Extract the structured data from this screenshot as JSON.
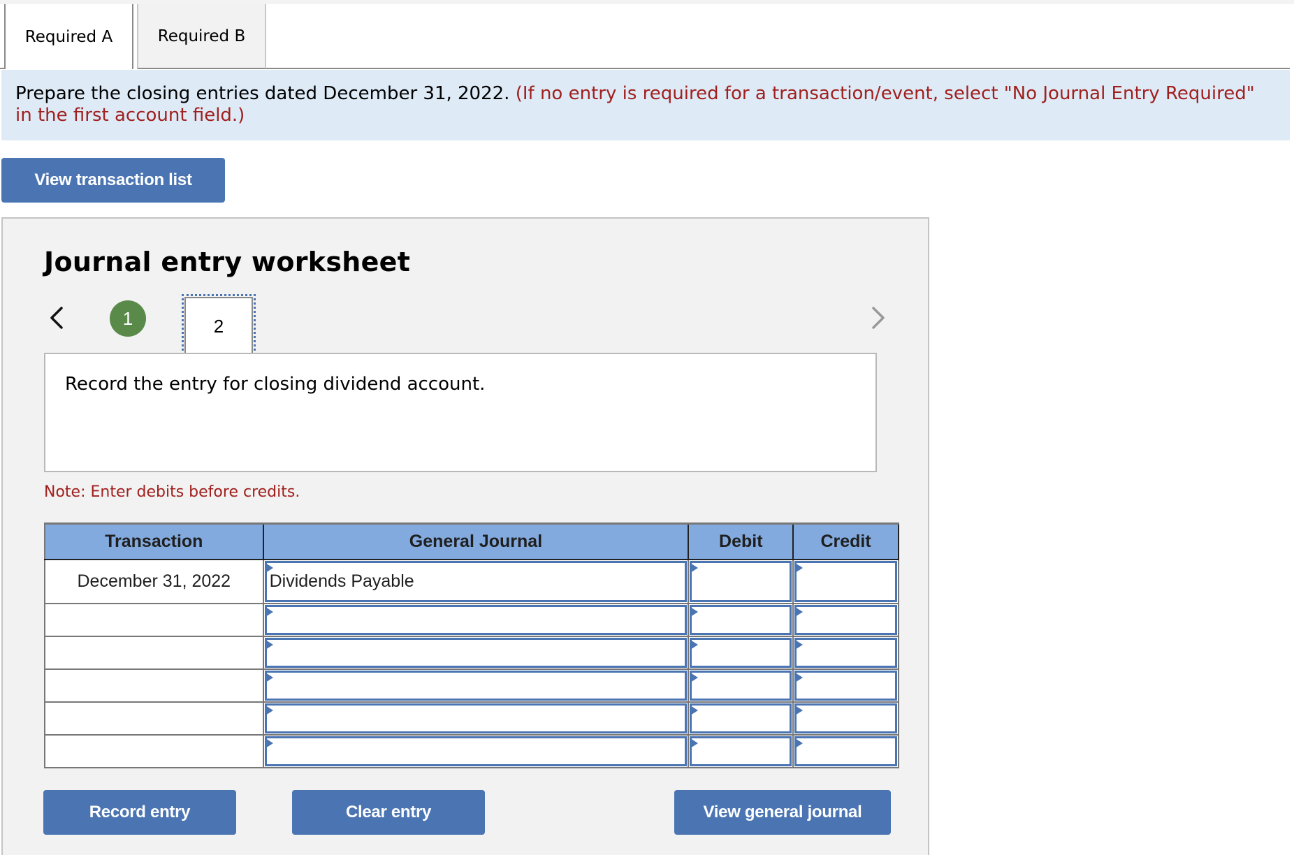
{
  "tabs": [
    {
      "label": "Required A",
      "active": true
    },
    {
      "label": "Required B",
      "active": false
    }
  ],
  "instructions": {
    "main_text": "Prepare the closing entries dated December 31, 2022.",
    "hint_text": "(If no entry is required for a transaction/event, select \"No Journal Entry Required\" in the first account field.)"
  },
  "view_transaction_list_label": "View transaction list",
  "worksheet": {
    "title": "Journal entry worksheet",
    "nav": {
      "prev_icon": "chevron-left-icon",
      "next_icon": "chevron-right-icon",
      "steps": [
        {
          "label": "1",
          "status": "completed"
        },
        {
          "label": "2",
          "status": "current"
        }
      ]
    },
    "description": "Record the entry for closing dividend account.",
    "note": "Note: Enter debits before credits.",
    "table": {
      "headers": [
        "Transaction",
        "General Journal",
        "Debit",
        "Credit"
      ],
      "rows": [
        {
          "transaction": "December 31, 2022",
          "account": "Dividends Payable",
          "debit": "",
          "credit": ""
        },
        {
          "transaction": "",
          "account": "",
          "debit": "",
          "credit": ""
        },
        {
          "transaction": "",
          "account": "",
          "debit": "",
          "credit": ""
        },
        {
          "transaction": "",
          "account": "",
          "debit": "",
          "credit": ""
        },
        {
          "transaction": "",
          "account": "",
          "debit": "",
          "credit": ""
        },
        {
          "transaction": "",
          "account": "",
          "debit": "",
          "credit": ""
        }
      ]
    },
    "buttons": {
      "record": "Record entry",
      "clear": "Clear entry",
      "view_general_journal": "View general journal"
    }
  },
  "colors": {
    "button_blue": "#4a74b2",
    "header_blue": "#82aade",
    "notice_bg": "#deebf7",
    "hint_red": "#a0201e",
    "step_green": "#5a8a4a"
  }
}
